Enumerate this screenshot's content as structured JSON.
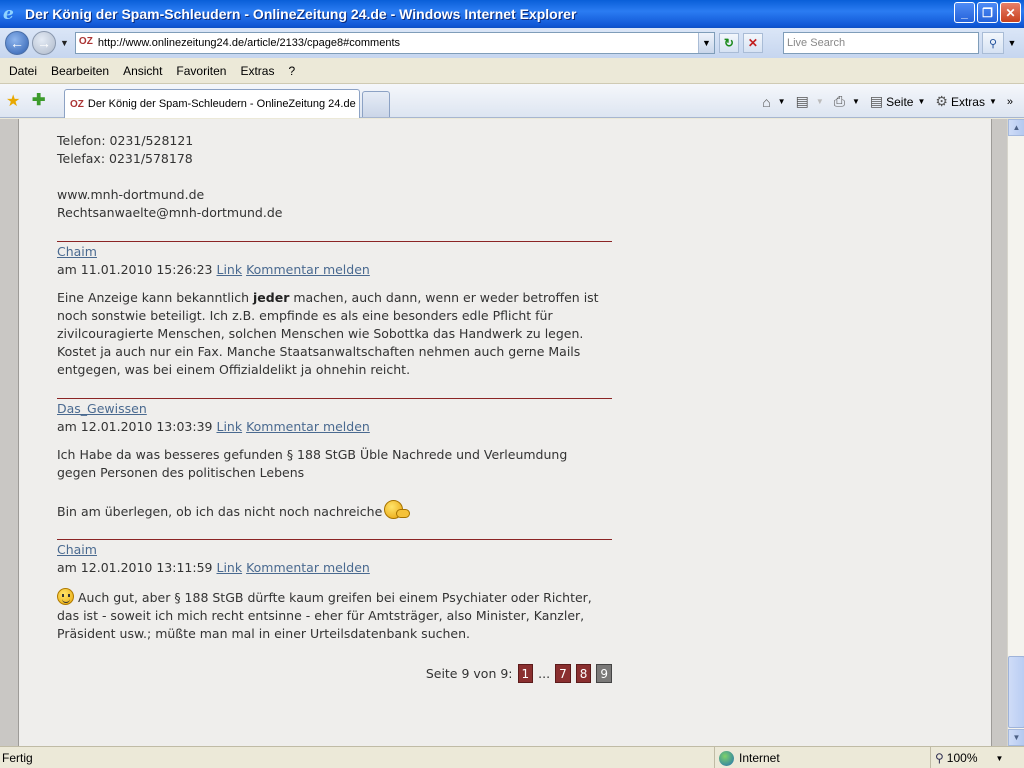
{
  "window": {
    "title": "Der König der Spam-Schleudern - OnlineZeitung 24.de - Windows Internet Explorer",
    "minimize": "_",
    "maximize": "❐",
    "close": "✕"
  },
  "address_bar": {
    "url": "http://www.onlinezeitung24.de/article/2133/cpage8#comments",
    "search_placeholder": "Live Search"
  },
  "menu": [
    "Datei",
    "Bearbeiten",
    "Ansicht",
    "Favoriten",
    "Extras",
    "?"
  ],
  "tab": {
    "label": "Der König der Spam-Schleudern - OnlineZeitung 24.de"
  },
  "command_bar": {
    "page_label": "Seite",
    "tools_label": "Extras"
  },
  "content": {
    "contact": {
      "phone": "Telefon: 0231/528121",
      "fax": "Telefax: 0231/578178",
      "web": "www.mnh-dortmund.de",
      "email": "Rechtsanwaelte@mnh-dortmund.de"
    },
    "comments": [
      {
        "author": "Chaim",
        "date": "am 11.01.2010 15:26:23",
        "link": "Link",
        "report": "Kommentar melden",
        "lines": [
          {
            "pre": "Eine Anzeige kann bekanntlich ",
            "bold": "jeder",
            "post": " machen, auch dann, wenn er weder betroffen ist"
          },
          {
            "text": "noch sonstwie beteiligt. Ich z.B. empfinde es als eine besonders edle Pflicht für"
          },
          {
            "text": "zivilcouragierte Menschen, solchen Menschen wie Sobottka das Handwerk zu legen."
          },
          {
            "text": "Kostet ja auch nur ein Fax. Manche Staatsanwaltschaften nehmen auch gerne Mails"
          },
          {
            "text": "entgegen, was bei einem Offizialdelikt ja ohnehin reicht."
          }
        ]
      },
      {
        "author": "Das_Gewissen",
        "date": "am 12.01.2010 13:03:39",
        "link": "Link",
        "report": "Kommentar melden",
        "lines": [
          {
            "text": "Ich Habe da was besseres gefunden § 188 StGB Üble Nachrede und Verleumdung"
          },
          {
            "text": "gegen Personen des politischen Lebens"
          },
          {
            "text": "Bin am überlegen, ob ich das nicht noch nachreiche"
          }
        ]
      },
      {
        "author": "Chaim",
        "date": "am 12.01.2010 13:11:59",
        "link": "Link",
        "report": "Kommentar melden",
        "lines": [
          {
            "text": " Auch gut, aber § 188 StGB dürfte kaum greifen bei einem Psychiater oder Richter,"
          },
          {
            "text": "das ist - soweit ich mich recht entsinne - eher für Amtsträger, also Minister, Kanzler,"
          },
          {
            "text": "Präsident usw.; müßte man mal in einer Urteilsdatenbank suchen."
          }
        ]
      }
    ],
    "pagination": {
      "label": "Seite 9 von 9:",
      "first": "1",
      "ellipsis": "...",
      "pages": [
        "7",
        "8"
      ],
      "current": "9"
    }
  },
  "status_bar": {
    "text": "Fertig",
    "zone": "Internet",
    "zoom": "100%"
  }
}
